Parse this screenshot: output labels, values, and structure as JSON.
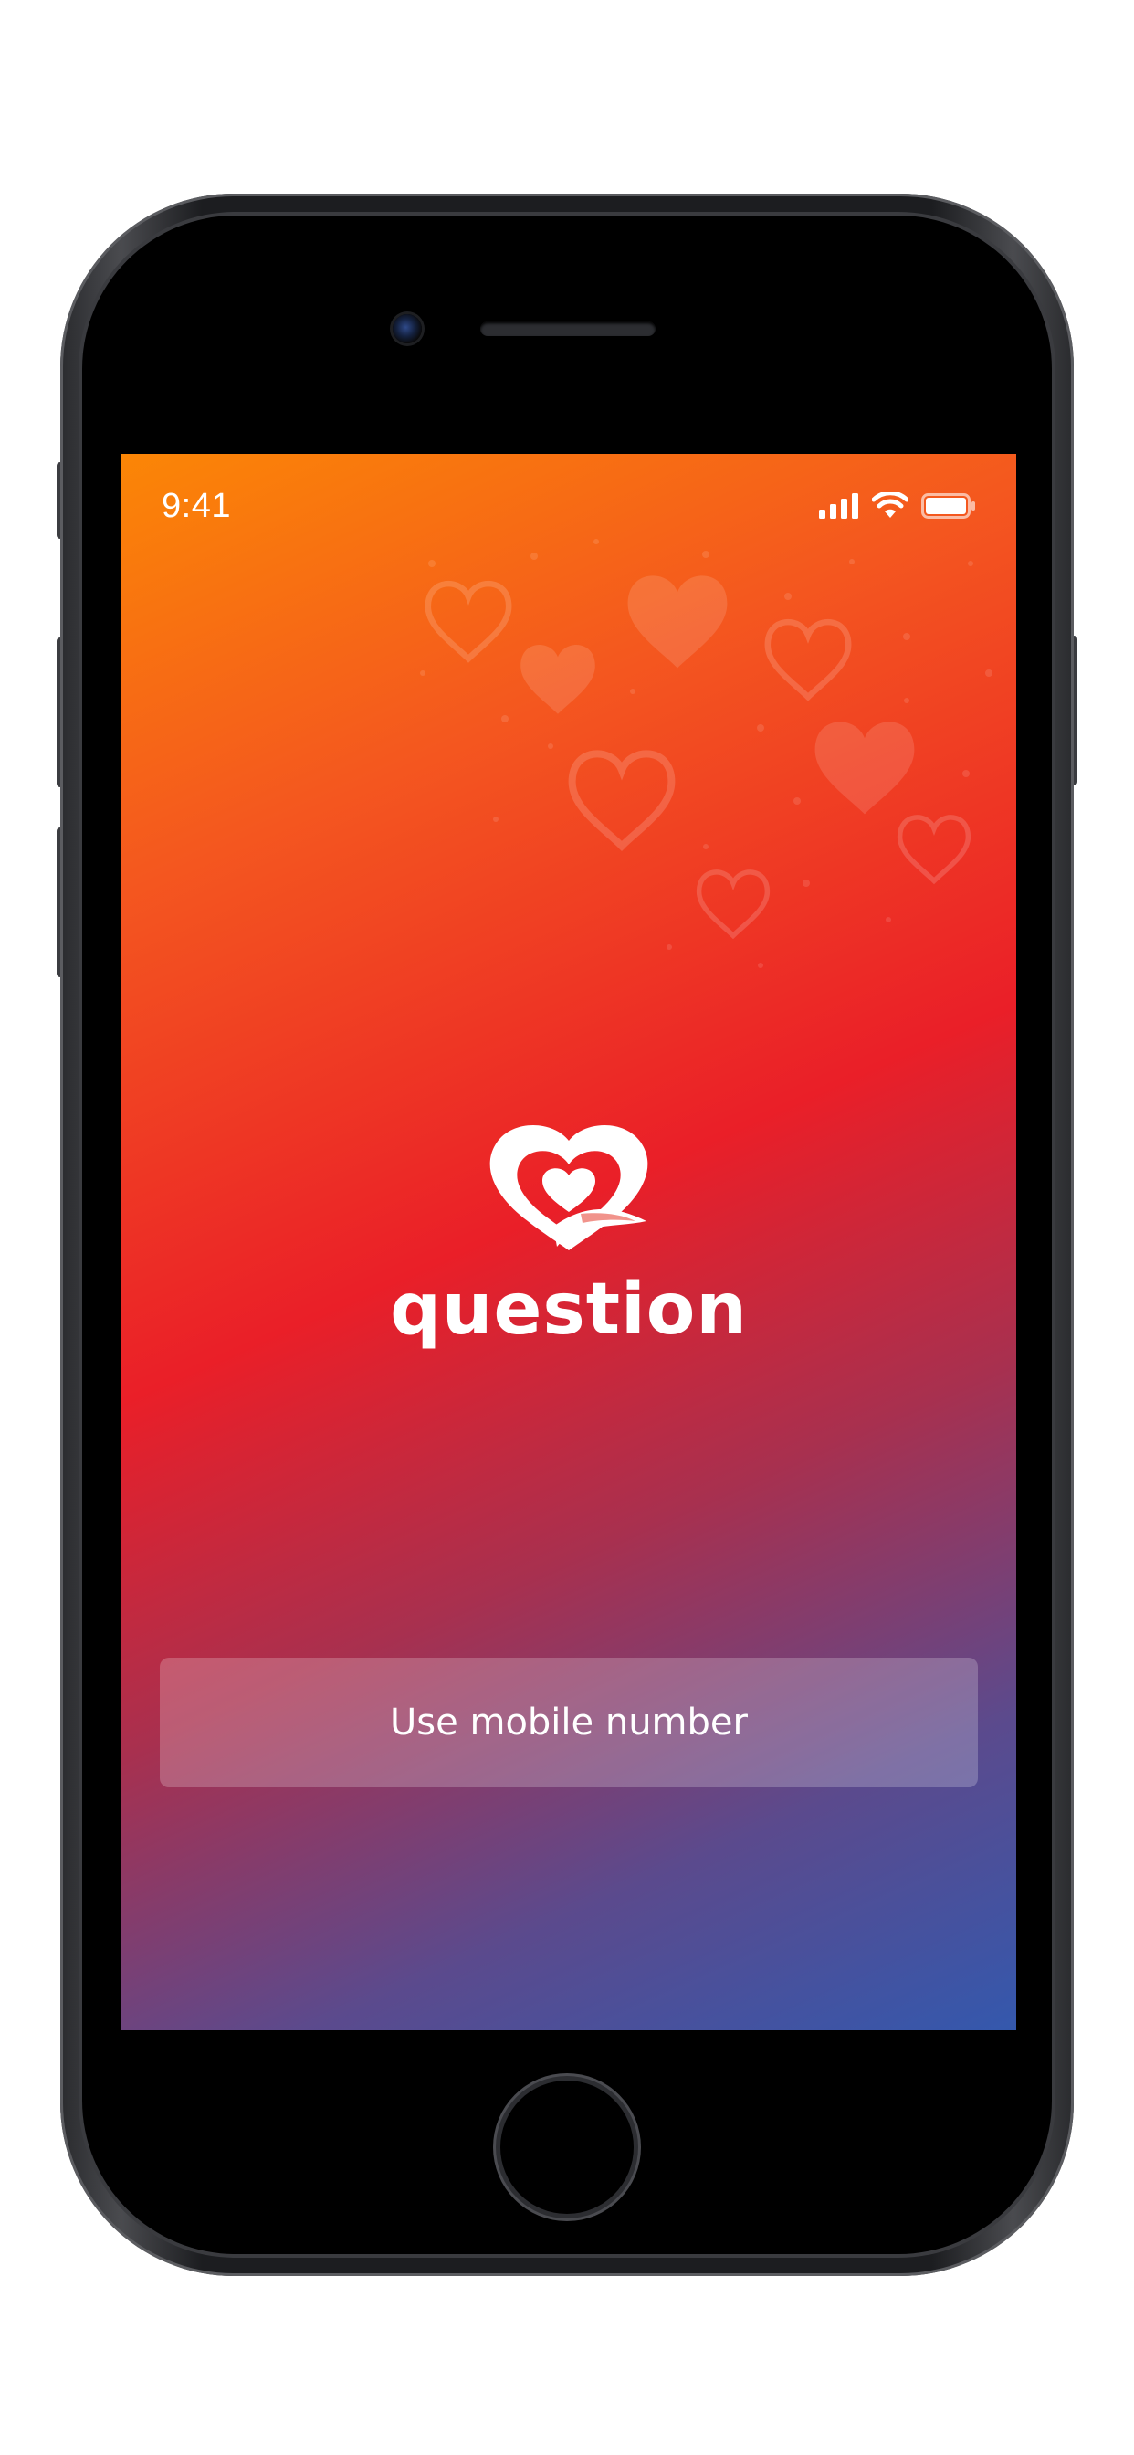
{
  "status_bar": {
    "time": "9:41",
    "icons": [
      "signal-icon",
      "wifi-icon",
      "battery-icon"
    ]
  },
  "app": {
    "name": "question",
    "logo_icon": "heart-ribbon-logo-icon"
  },
  "actions": {
    "mobile_button_label": "Use mobile number"
  },
  "colors": {
    "gradient_top": "#fb8606",
    "gradient_middle": "#ea1f28",
    "gradient_bottom": "#3458ad",
    "text": "#ffffff"
  }
}
